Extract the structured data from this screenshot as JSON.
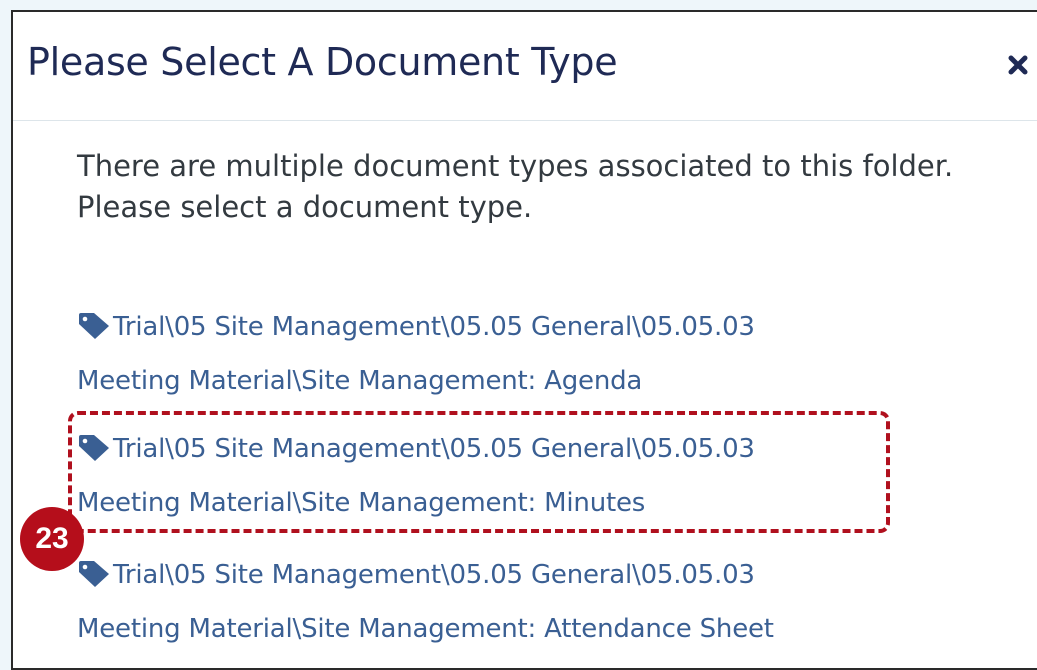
{
  "dialog": {
    "title": "Please Select A Document Type",
    "close_icon": "close-x-icon",
    "intro_text": "There are multiple document types associated to this folder. Please select a document type.",
    "document_types": [
      {
        "icon": "tag-icon",
        "line1": "Trial\\05 Site Management\\05.05 General\\05.05.03",
        "line2": "Meeting Material\\Site Management: Agenda"
      },
      {
        "icon": "tag-icon",
        "line1": "Trial\\05 Site Management\\05.05 General\\05.05.03",
        "line2": "Meeting Material\\Site Management: Minutes"
      },
      {
        "icon": "tag-icon",
        "line1": "Trial\\05 Site Management\\05.05 General\\05.05.03",
        "line2": "Meeting Material\\Site Management: Attendance Sheet"
      }
    ]
  },
  "annotation": {
    "step_number": "23",
    "highlight_color": "#b0101e",
    "badge_color": "#b50e1b"
  },
  "colors": {
    "title": "#1f2a55",
    "link": "#3a5f93",
    "body_text": "#333a40",
    "page_background": "#eef6fa"
  }
}
